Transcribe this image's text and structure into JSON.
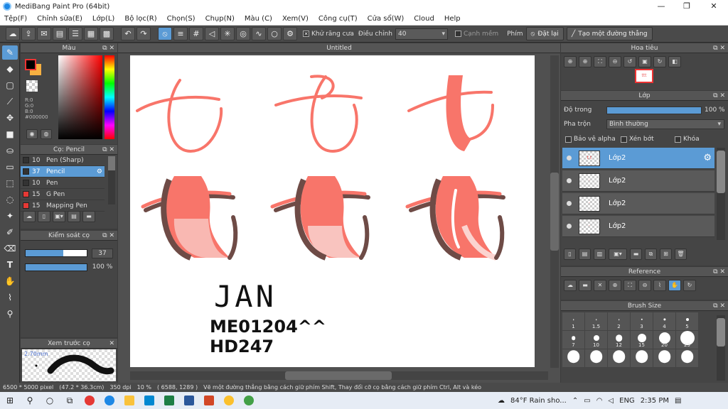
{
  "window": {
    "title": "MediBang Paint Pro (64bit)",
    "minimize": "—",
    "maximize": "❐",
    "close": "✕"
  },
  "menu": [
    "Tệp(F)",
    "Chỉnh sửa(E)",
    "Lớp(L)",
    "Bộ lọc(R)",
    "Chọn(S)",
    "Chụp(N)",
    "Màu (C)",
    "Xem(V)",
    "Công cụ(T)",
    "Cửa sổ(W)",
    "Cloud",
    "Help"
  ],
  "toolbar": {
    "antialias_label": "Khử răng cưa",
    "adjust_label": "Điều chỉnh",
    "adjust_value": "40",
    "edge_label": "Cạnh mềm",
    "key_label": "Phím",
    "reset_label": "Đặt lại",
    "line_label": "Tạo một đường thẳng"
  },
  "color_panel": {
    "title": "Màu",
    "r": "R:0",
    "g": "G:0",
    "b": "B:0",
    "hex": "#000000",
    "fg": "#000000",
    "bg": "#f6b041"
  },
  "brush_panel": {
    "title": "Cọ: Pencil",
    "items": [
      {
        "size": "10",
        "name": "Pen (Sharp)",
        "color": "#333333"
      },
      {
        "size": "37",
        "name": "Pencil",
        "color": "#333333"
      },
      {
        "size": "10",
        "name": "Pen",
        "color": "#333333"
      },
      {
        "size": "15",
        "name": "G Pen",
        "color": "#e53935"
      },
      {
        "size": "15",
        "name": "Mapping Pen",
        "color": "#e53935"
      }
    ]
  },
  "brush_control": {
    "title": "Kiểm soát cọ",
    "size_value": "37",
    "size_fraction": 0.62,
    "opacity_value": "100 %",
    "opacity_fraction": 1.0
  },
  "preview": {
    "title": "Xem trước cọ",
    "size": "2.70mm"
  },
  "canvas": {
    "tab": "Untitled",
    "text_line1": "JAN",
    "text_line2": "ME01204^^",
    "text_line3": "HD247"
  },
  "navigator": {
    "title": "Hoa tiêu"
  },
  "layers": {
    "title": "Lớp",
    "opacity_label": "Độ trong",
    "opacity_value": "100 %",
    "blend_label": "Pha trộn",
    "blend_value": "Bình thường",
    "protect_alpha": "Bảo vệ alpha",
    "clip": "Xén bớt",
    "lock": "Khóa",
    "items": [
      "Lớp2",
      "Lớp2",
      "Lớp2",
      "Lớp2"
    ]
  },
  "reference": {
    "title": "Reference"
  },
  "brush_size": {
    "title": "Brush Size",
    "sizes": [
      "1",
      "1.5",
      "2",
      "3",
      "4",
      "5",
      "7",
      "10",
      "12",
      "15",
      "20",
      "25",
      "",
      "",
      "",
      "",
      "",
      ""
    ]
  },
  "status": {
    "dims": "6500 * 5000 pixel",
    "cm": "(47.2 * 36.3cm)",
    "dpi": "350 dpi",
    "zoom": "10 %",
    "coords": "( 6588, 1289 )",
    "hint": "Vẽ một đường thẳng bằng cách giữ phím Shift, Thay đổi cỡ cọ bằng cách giữ phím Ctrl, Alt và kéo"
  },
  "taskbar": {
    "weather": "84°F  Rain sho...",
    "lang": "ENG",
    "time": "2:35 PM"
  },
  "colors": {
    "accent": "#5b9bd5",
    "stroke": "#f8756a",
    "shadow": "#6e4b46",
    "light": "#f9b8b2"
  }
}
